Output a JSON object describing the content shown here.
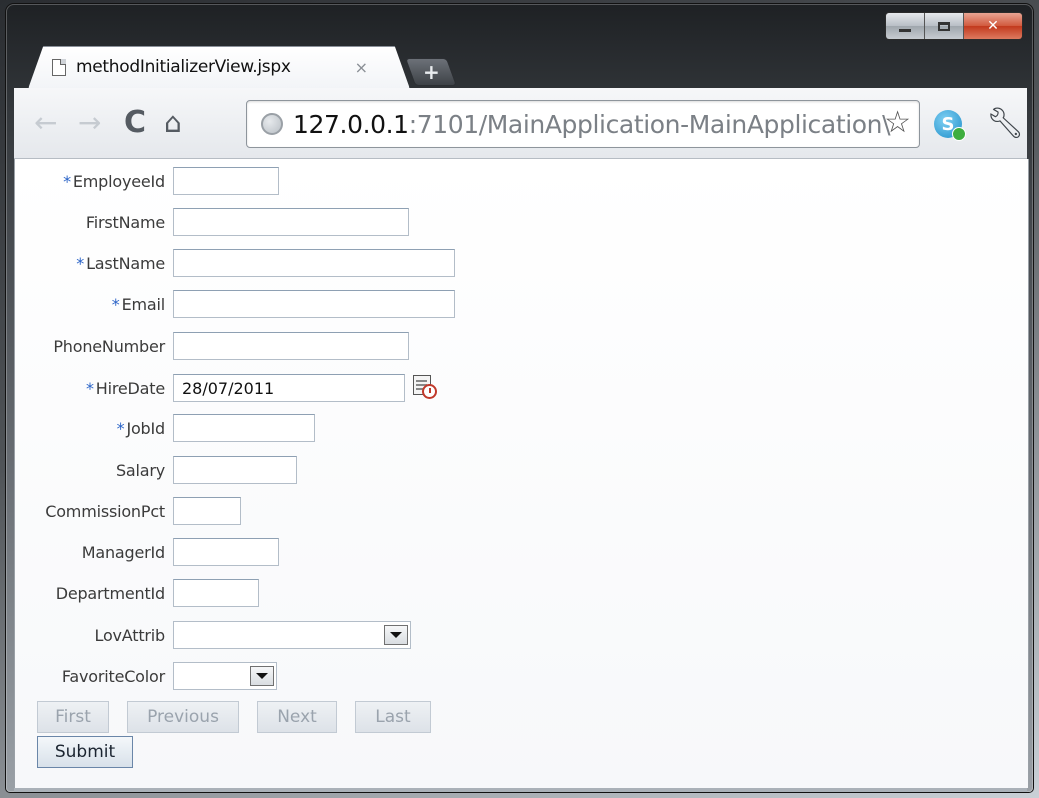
{
  "browser": {
    "tab_title": "methodInitializerView.jspx",
    "tab_close": "×",
    "new_tab": "+",
    "url_host": "127.0.0.1",
    "url_rest": ":7101/MainApplication-MainApplication\\",
    "icons": {
      "back": "back-arrow-icon",
      "forward": "forward-arrow-icon",
      "reload": "reload-icon",
      "home": "home-icon",
      "site": "globe-icon",
      "bookmark": "star-icon",
      "skype": "skype-icon",
      "settings": "wrench-icon"
    }
  },
  "form": {
    "required_marker": "*",
    "fields": {
      "employee_id": {
        "label": "EmployeeId",
        "value": ""
      },
      "first_name": {
        "label": "FirstName",
        "value": ""
      },
      "last_name": {
        "label": "LastName",
        "value": ""
      },
      "email": {
        "label": "Email",
        "value": ""
      },
      "phone_number": {
        "label": "PhoneNumber",
        "value": ""
      },
      "hire_date": {
        "label": "HireDate",
        "value": "28/07/2011"
      },
      "job_id": {
        "label": "JobId",
        "value": ""
      },
      "salary": {
        "label": "Salary",
        "value": ""
      },
      "commission_pct": {
        "label": "CommissionPct",
        "value": ""
      },
      "manager_id": {
        "label": "ManagerId",
        "value": ""
      },
      "department_id": {
        "label": "DepartmentId",
        "value": ""
      },
      "lov_attrib": {
        "label": "LovAttrib",
        "value": ""
      },
      "favorite_color": {
        "label": "FavoriteColor",
        "value": ""
      }
    }
  },
  "buttons": {
    "first": "First",
    "previous": "Previous",
    "next": "Next",
    "last": "Last",
    "submit": "Submit"
  },
  "colors": {
    "required": "#2a63c7",
    "label": "#3b3b3b",
    "disabled_text": "#9aa3ad",
    "close_button": "#c2391d"
  }
}
